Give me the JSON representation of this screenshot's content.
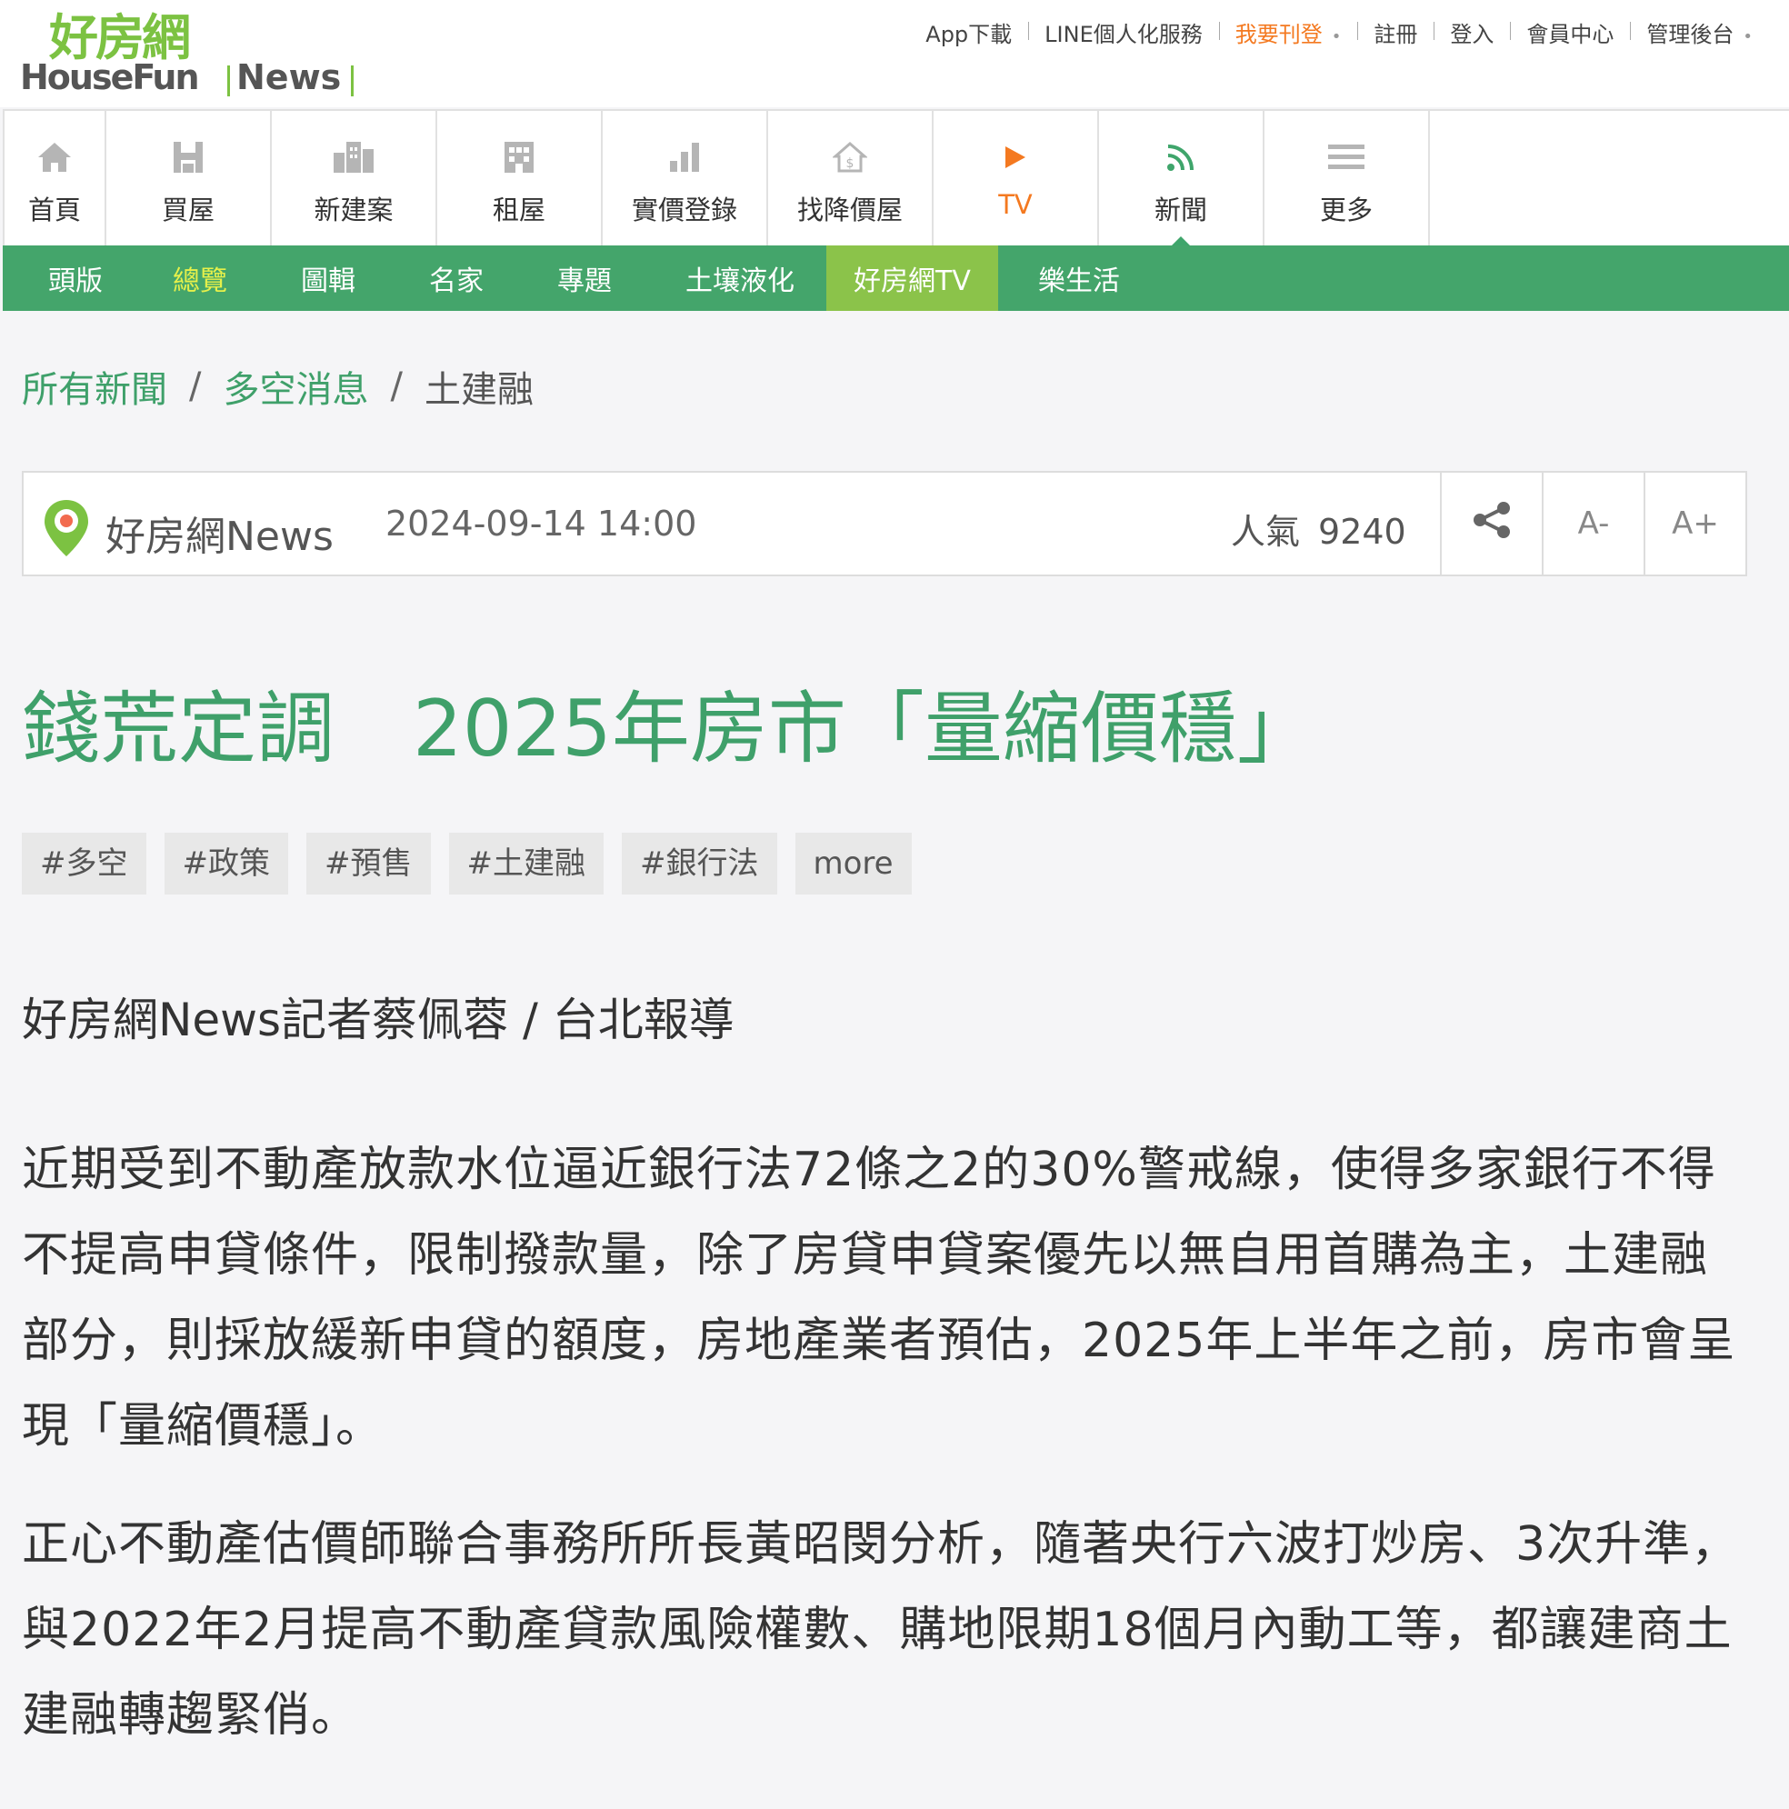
{
  "header": {
    "logo_cn": "好房網",
    "logo_en": "HouseFun",
    "logo_news": "News",
    "top_links": [
      {
        "label": "App下載",
        "highlight": false
      },
      {
        "label": "LINE個人化服務",
        "highlight": false
      },
      {
        "label": "我要刊登",
        "highlight": true
      },
      {
        "label": "註冊",
        "highlight": false
      },
      {
        "label": "登入",
        "highlight": false
      },
      {
        "label": "會員中心",
        "highlight": false
      },
      {
        "label": "管理後台",
        "highlight": false
      }
    ]
  },
  "main_nav": [
    {
      "label": "首頁",
      "icon": "home-icon"
    },
    {
      "label": "買屋",
      "icon": "house-buy-icon"
    },
    {
      "label": "新建案",
      "icon": "buildings-icon"
    },
    {
      "label": "租屋",
      "icon": "apartment-icon"
    },
    {
      "label": "實價登錄",
      "icon": "bar-chart-icon"
    },
    {
      "label": "找降價屋",
      "icon": "price-drop-house-icon"
    },
    {
      "label": "TV",
      "icon": "play-icon"
    },
    {
      "label": "新聞",
      "icon": "rss-icon",
      "active": true
    },
    {
      "label": "更多",
      "icon": "menu-icon"
    }
  ],
  "sub_nav": [
    "頭版",
    "總覽",
    "圖輯",
    "名家",
    "專題",
    "土壤液化",
    "好房網TV",
    "樂生活"
  ],
  "breadcrumb": [
    "所有新聞",
    "多空消息",
    "土建融"
  ],
  "info_bar": {
    "source": "好房網News",
    "datetime": "2024-09-14 14:00",
    "popularity_label": "人氣",
    "popularity_value": "9240",
    "font_smaller": "A-",
    "font_larger": "A+"
  },
  "article": {
    "title": "錢荒定調　2025年房市「量縮價穩」",
    "tags": [
      "#多空",
      "#政策",
      "#預售",
      "#土建融",
      "#銀行法",
      "more"
    ],
    "byline": "好房網News記者蔡佩蓉 / 台北報導",
    "paragraphs": [
      "近期受到不動產放款水位逼近銀行法72條之2的30%警戒線，使得多家銀行不得不提高申貸條件，限制撥款量，除了房貸申貸案優先以無自用首購為主，土建融部分，則採放緩新申貸的額度，房地產業者預估，2025年上半年之前，房市會呈現「量縮價穩」。",
      "正心不動產估價師聯合事務所所長黃昭閔分析，隨著央行六波打炒房、3次升準，與2022年2月提高不動產貸款風險權數、購地限期18個月內動工等，都讓建商土建融轉趨緊俏。"
    ]
  },
  "colors": {
    "brand_green": "#44a56b",
    "logo_green": "#7cc242",
    "accent_orange": "#f47920",
    "subnav_current": "#e6f04a",
    "tv_tab_bg": "#8bc34a"
  }
}
